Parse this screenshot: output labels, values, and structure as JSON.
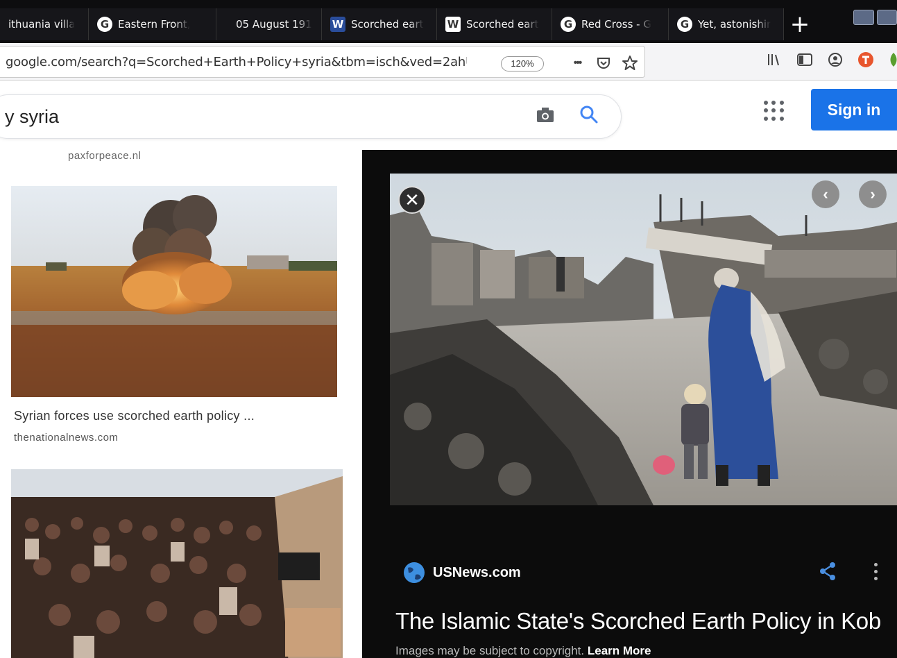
{
  "tabs": [
    {
      "label": "ithuania villa",
      "icon": ""
    },
    {
      "label": "Eastern Front,",
      "icon": "google-icon"
    },
    {
      "label": "05 August 191",
      "icon": ""
    },
    {
      "label": "Scorched eart",
      "icon": "wiki-icon"
    },
    {
      "label": "Scorched eart",
      "icon": "wikipedia-icon"
    },
    {
      "label": "Red Cross - G",
      "icon": "google-icon"
    },
    {
      "label": "Yet, astonishir",
      "icon": "google-icon"
    }
  ],
  "tab_icon_letters": {
    "google": "G",
    "wikipedia": "W",
    "wiki": "W"
  },
  "new_tab": "+",
  "navbar": {
    "url": "google.com/search?q=Scorched+Earth+Policy+syria&tbm=isch&ved=2ahUK",
    "zoom": "120%",
    "more": "•••"
  },
  "search": {
    "query": "y syria",
    "signin": "Sign in"
  },
  "results": {
    "top_source": "paxforpeace.nl",
    "caption": "Syrian forces use scorched earth policy ...",
    "domain": "thenationalnews.com"
  },
  "preview": {
    "close": "✕",
    "prev": "‹",
    "next": "›",
    "site": "USNews.com",
    "title": "The Islamic State's Scorched Earth Policy in Kob",
    "copyright": "Images may be subject to copyright.",
    "learn_more": "Learn More"
  },
  "colors": {
    "accent": "#1a73e8",
    "tabbar": "#0d0d0f",
    "preview_bg": "#0c0c0c"
  }
}
